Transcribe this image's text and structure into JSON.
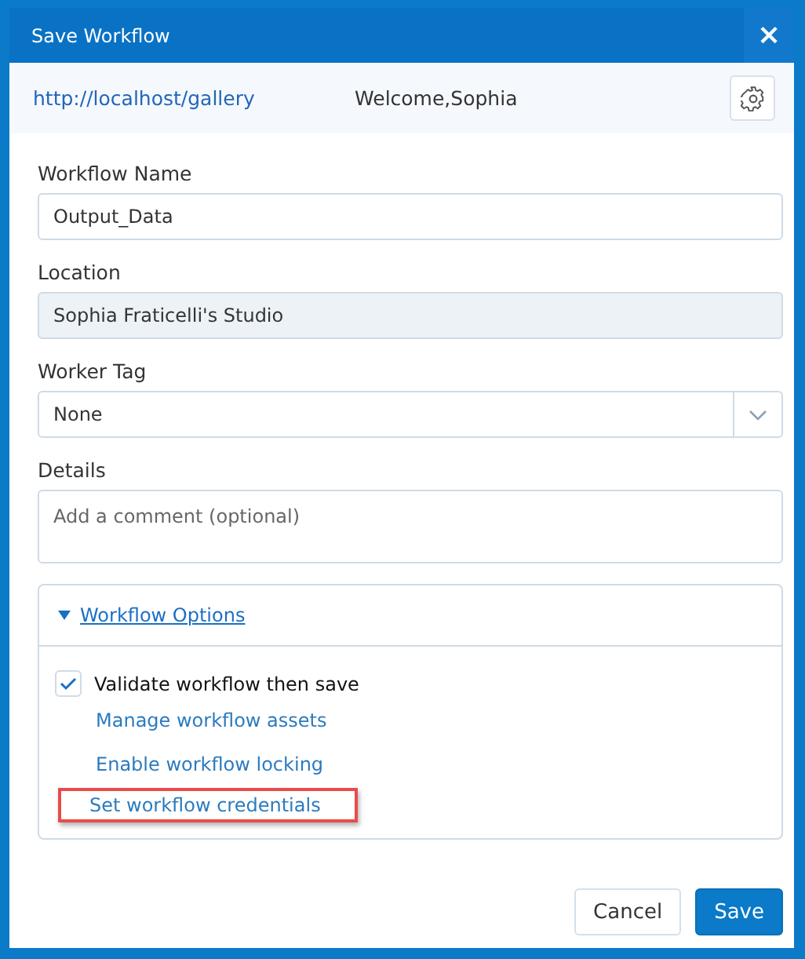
{
  "window": {
    "title": "Save Workflow",
    "close": "×"
  },
  "header": {
    "url": "http://localhost/gallery",
    "welcome": "Welcome,Sophia"
  },
  "fields": [
    {
      "kind": "text",
      "label": "Workflow Name",
      "value": "Output_Data"
    },
    {
      "kind": "readonly",
      "label": "Location",
      "value": "Sophia Fraticelli's Studio"
    },
    {
      "kind": "select",
      "label": "Worker Tag",
      "value": "None"
    },
    {
      "kind": "textarea",
      "label": "Details",
      "placeholder": "Add a comment (optional)"
    }
  ],
  "options": {
    "title": "Workflow Options",
    "expanded": true,
    "checkbox": {
      "label": "Validate workflow then save",
      "checked": true
    },
    "links": [
      {
        "label": "Manage workflow assets",
        "highlighted": false
      },
      {
        "label": "Enable workflow locking",
        "highlighted": false
      },
      {
        "label": "Set workflow credentials",
        "highlighted": true
      }
    ]
  },
  "buttons": [
    {
      "label": "Cancel",
      "kind": "secondary"
    },
    {
      "label": "Save",
      "kind": "primary"
    }
  ]
}
